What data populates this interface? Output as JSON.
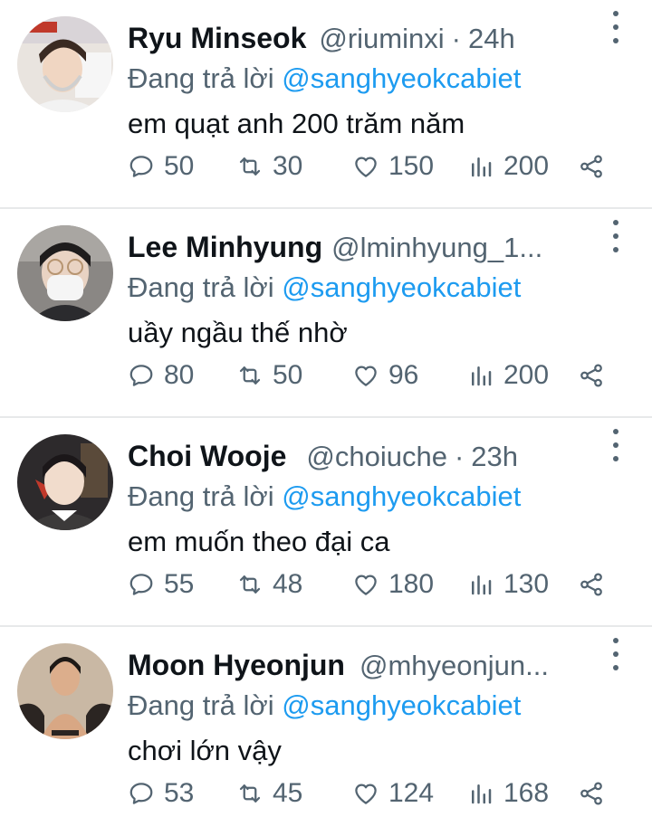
{
  "replying_prefix": "Đang trả lời",
  "colors": {
    "accent": "#1d9bf0",
    "secondary_text": "#536471"
  },
  "tweets": [
    {
      "name": "Ryu Minseok",
      "handle": "@riuminxi",
      "separator": "·",
      "time": "24h",
      "mention": "@sanghyeokcabiet",
      "text": "em quạt anh 200 trăm năm",
      "replies": "50",
      "retweets": "30",
      "likes": "150",
      "views": "200"
    },
    {
      "name": "Lee Minhyung",
      "handle": "@lminhyung_1...",
      "separator": "",
      "time": "",
      "mention": "@sanghyeokcabiet",
      "text": "uầy ngầu thế nhờ",
      "replies": "80",
      "retweets": "50",
      "likes": "96",
      "views": "200"
    },
    {
      "name": "Choi Wooje",
      "handle": "@choiuche",
      "separator": "·",
      "time": "23h",
      "mention": "@sanghyeokcabiet",
      "text": "em muốn theo đại ca",
      "replies": "55",
      "retweets": "48",
      "likes": "180",
      "views": "130"
    },
    {
      "name": "Moon Hyeonjun",
      "handle": "@mhyeonjun...",
      "separator": "",
      "time": "",
      "mention": "@sanghyeokcabiet",
      "text": "chơi lớn vậy",
      "replies": "53",
      "retweets": "45",
      "likes": "124",
      "views": "168"
    }
  ]
}
